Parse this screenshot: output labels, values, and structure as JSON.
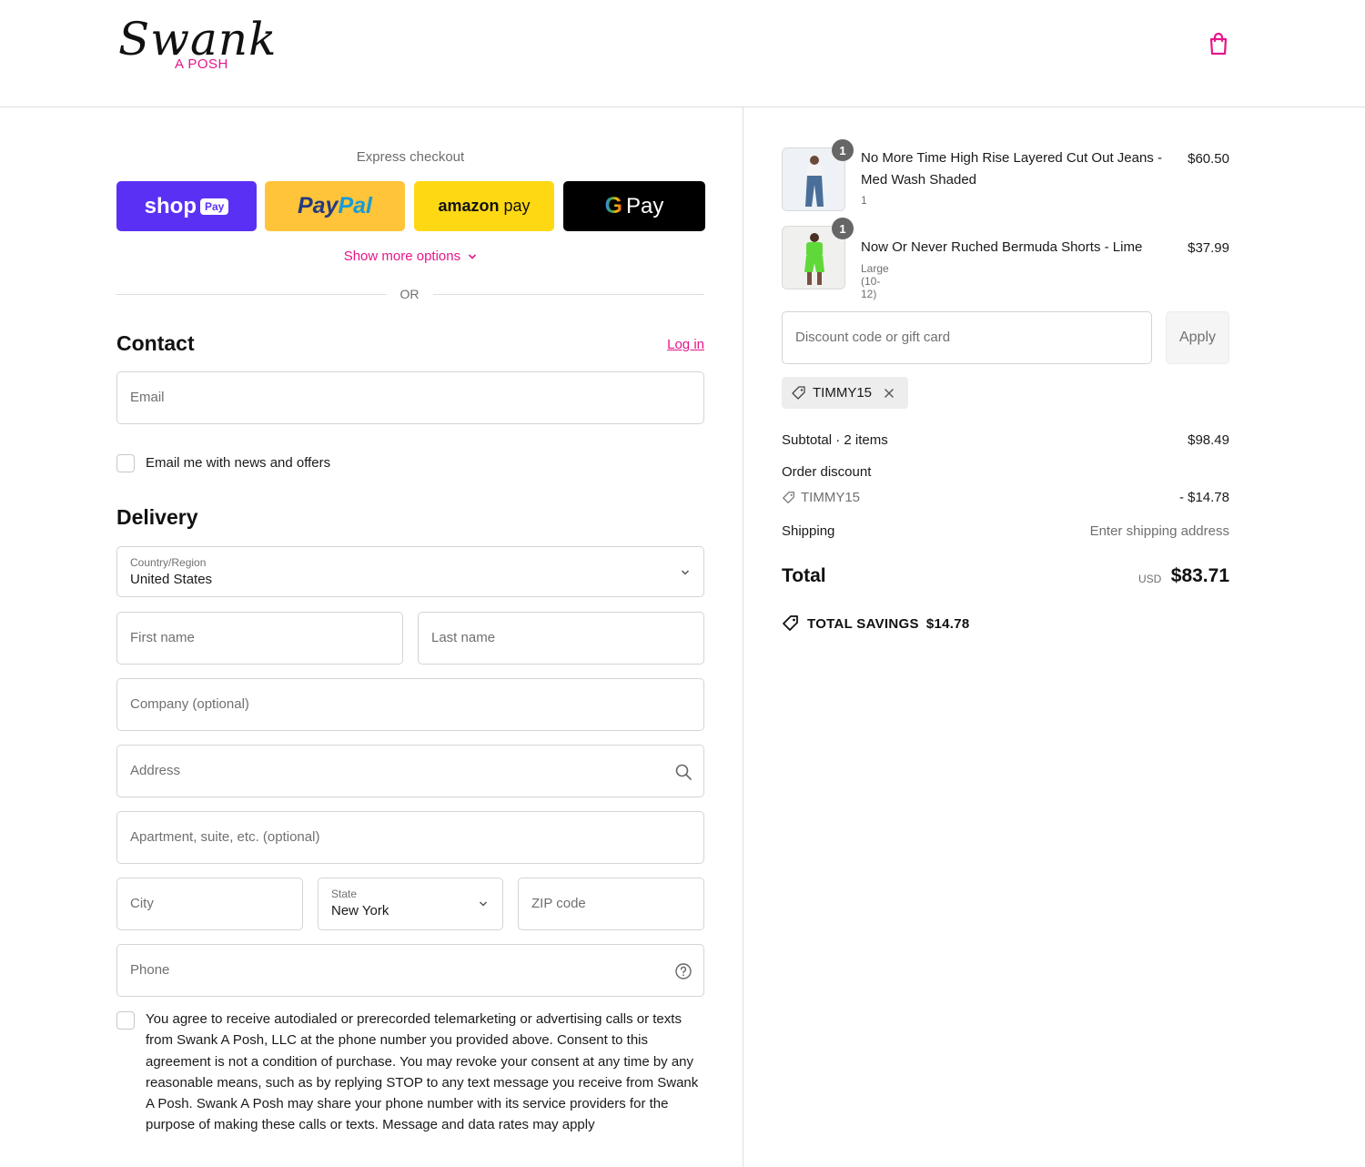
{
  "brand": {
    "logo_word": "Swank",
    "logo_sub": "A POSH",
    "accent_color": "#e6168a"
  },
  "header": {
    "cart_icon": "shopping-bag-icon"
  },
  "express": {
    "label": "Express checkout",
    "shop_pay": {
      "text": "shop",
      "badge": "Pay",
      "color": "#5a31f4"
    },
    "paypal": {
      "part1": "Pay",
      "part2": "Pal",
      "color": "#ffc439"
    },
    "amazon_pay": {
      "part1": "amazon",
      "part2": " pay",
      "color": "#ffd814"
    },
    "google_pay": {
      "g": "G",
      "text": "Pay",
      "color": "#000000"
    },
    "more_options": "Show more options",
    "or": "OR"
  },
  "contact": {
    "title": "Contact",
    "login": "Log in",
    "email_placeholder": "Email",
    "news_label": "Email me with news and offers"
  },
  "delivery": {
    "title": "Delivery",
    "country_label": "Country/Region",
    "country_value": "United States",
    "first_name": "First name",
    "last_name": "Last name",
    "company": "Company (optional)",
    "address": "Address",
    "apartment": "Apartment, suite, etc. (optional)",
    "city": "City",
    "state_label": "State",
    "state_value": "New York",
    "zip": "ZIP code",
    "phone": "Phone",
    "consent": "You agree to receive autodialed or prerecorded telemarketing or advertising calls or texts from Swank A Posh, LLC at the phone number you provided above. Consent to this agreement is not a condition of purchase. You may revoke  your consent at any time by any reasonable means, such as by replying STOP to any text message you receive from Swank A Posh. Swank A Posh may share your phone number with its service providers for the purpose of making these calls or texts. Message and data rates may apply"
  },
  "order": {
    "items": [
      {
        "qty": "1",
        "title": "No More Time High Rise Layered Cut Out Jeans - Med Wash Shaded",
        "variant": "1",
        "price": "$60.50"
      },
      {
        "qty": "1",
        "title": "Now Or Never Ruched Bermuda Shorts - Lime",
        "variant": "Large (10-12)",
        "price": "$37.99"
      }
    ],
    "discount_placeholder": "Discount code or gift card",
    "apply": "Apply",
    "applied_code": "TIMMY15",
    "subtotal_label": "Subtotal · 2 items",
    "subtotal_value": "$98.49",
    "order_discount_label": "Order discount",
    "discount_code": "TIMMY15",
    "discount_value": "- $14.78",
    "shipping_label": "Shipping",
    "shipping_value": "Enter shipping address",
    "total_label": "Total",
    "currency": "USD",
    "total_value": "$83.71",
    "savings_label": "TOTAL SAVINGS",
    "savings_value": "$14.78"
  }
}
